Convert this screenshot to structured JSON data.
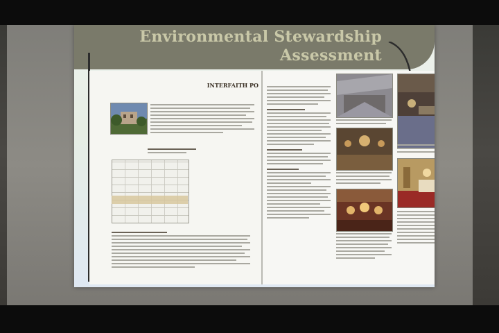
{
  "slide": {
    "title": "Environmental Stewardship\nAssessment"
  },
  "document": {
    "left_heading": "INTERFAITH PO",
    "left_subheading": "",
    "photos": [
      {
        "name": "building-exterior-photo"
      },
      {
        "name": "interior-ceiling-photo"
      },
      {
        "name": "ballroom-photo"
      },
      {
        "name": "chandelier-hall-photo"
      },
      {
        "name": "dining-room-photo"
      },
      {
        "name": "ornate-ceiling-photo"
      },
      {
        "name": "meeting-room-photo"
      }
    ]
  },
  "colors": {
    "banner": "#7a7a6a",
    "banner_text": "#c9c8a8",
    "slide_background": "#e6eee4"
  }
}
